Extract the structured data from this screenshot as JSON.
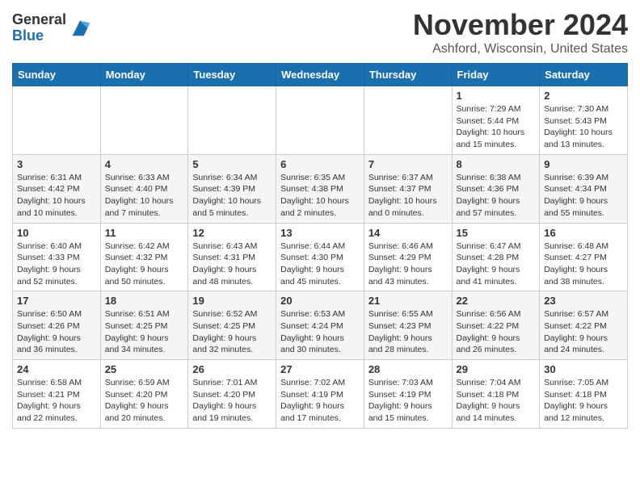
{
  "header": {
    "logo_general": "General",
    "logo_blue": "Blue",
    "month_title": "November 2024",
    "location": "Ashford, Wisconsin, United States"
  },
  "days_of_week": [
    "Sunday",
    "Monday",
    "Tuesday",
    "Wednesday",
    "Thursday",
    "Friday",
    "Saturday"
  ],
  "weeks": [
    [
      {
        "day": "",
        "detail": ""
      },
      {
        "day": "",
        "detail": ""
      },
      {
        "day": "",
        "detail": ""
      },
      {
        "day": "",
        "detail": ""
      },
      {
        "day": "",
        "detail": ""
      },
      {
        "day": "1",
        "detail": "Sunrise: 7:29 AM\nSunset: 5:44 PM\nDaylight: 10 hours and 15 minutes."
      },
      {
        "day": "2",
        "detail": "Sunrise: 7:30 AM\nSunset: 5:43 PM\nDaylight: 10 hours and 13 minutes."
      }
    ],
    [
      {
        "day": "3",
        "detail": "Sunrise: 6:31 AM\nSunset: 4:42 PM\nDaylight: 10 hours and 10 minutes."
      },
      {
        "day": "4",
        "detail": "Sunrise: 6:33 AM\nSunset: 4:40 PM\nDaylight: 10 hours and 7 minutes."
      },
      {
        "day": "5",
        "detail": "Sunrise: 6:34 AM\nSunset: 4:39 PM\nDaylight: 10 hours and 5 minutes."
      },
      {
        "day": "6",
        "detail": "Sunrise: 6:35 AM\nSunset: 4:38 PM\nDaylight: 10 hours and 2 minutes."
      },
      {
        "day": "7",
        "detail": "Sunrise: 6:37 AM\nSunset: 4:37 PM\nDaylight: 10 hours and 0 minutes."
      },
      {
        "day": "8",
        "detail": "Sunrise: 6:38 AM\nSunset: 4:36 PM\nDaylight: 9 hours and 57 minutes."
      },
      {
        "day": "9",
        "detail": "Sunrise: 6:39 AM\nSunset: 4:34 PM\nDaylight: 9 hours and 55 minutes."
      }
    ],
    [
      {
        "day": "10",
        "detail": "Sunrise: 6:40 AM\nSunset: 4:33 PM\nDaylight: 9 hours and 52 minutes."
      },
      {
        "day": "11",
        "detail": "Sunrise: 6:42 AM\nSunset: 4:32 PM\nDaylight: 9 hours and 50 minutes."
      },
      {
        "day": "12",
        "detail": "Sunrise: 6:43 AM\nSunset: 4:31 PM\nDaylight: 9 hours and 48 minutes."
      },
      {
        "day": "13",
        "detail": "Sunrise: 6:44 AM\nSunset: 4:30 PM\nDaylight: 9 hours and 45 minutes."
      },
      {
        "day": "14",
        "detail": "Sunrise: 6:46 AM\nSunset: 4:29 PM\nDaylight: 9 hours and 43 minutes."
      },
      {
        "day": "15",
        "detail": "Sunrise: 6:47 AM\nSunset: 4:28 PM\nDaylight: 9 hours and 41 minutes."
      },
      {
        "day": "16",
        "detail": "Sunrise: 6:48 AM\nSunset: 4:27 PM\nDaylight: 9 hours and 38 minutes."
      }
    ],
    [
      {
        "day": "17",
        "detail": "Sunrise: 6:50 AM\nSunset: 4:26 PM\nDaylight: 9 hours and 36 minutes."
      },
      {
        "day": "18",
        "detail": "Sunrise: 6:51 AM\nSunset: 4:25 PM\nDaylight: 9 hours and 34 minutes."
      },
      {
        "day": "19",
        "detail": "Sunrise: 6:52 AM\nSunset: 4:25 PM\nDaylight: 9 hours and 32 minutes."
      },
      {
        "day": "20",
        "detail": "Sunrise: 6:53 AM\nSunset: 4:24 PM\nDaylight: 9 hours and 30 minutes."
      },
      {
        "day": "21",
        "detail": "Sunrise: 6:55 AM\nSunset: 4:23 PM\nDaylight: 9 hours and 28 minutes."
      },
      {
        "day": "22",
        "detail": "Sunrise: 6:56 AM\nSunset: 4:22 PM\nDaylight: 9 hours and 26 minutes."
      },
      {
        "day": "23",
        "detail": "Sunrise: 6:57 AM\nSunset: 4:22 PM\nDaylight: 9 hours and 24 minutes."
      }
    ],
    [
      {
        "day": "24",
        "detail": "Sunrise: 6:58 AM\nSunset: 4:21 PM\nDaylight: 9 hours and 22 minutes."
      },
      {
        "day": "25",
        "detail": "Sunrise: 6:59 AM\nSunset: 4:20 PM\nDaylight: 9 hours and 20 minutes."
      },
      {
        "day": "26",
        "detail": "Sunrise: 7:01 AM\nSunset: 4:20 PM\nDaylight: 9 hours and 19 minutes."
      },
      {
        "day": "27",
        "detail": "Sunrise: 7:02 AM\nSunset: 4:19 PM\nDaylight: 9 hours and 17 minutes."
      },
      {
        "day": "28",
        "detail": "Sunrise: 7:03 AM\nSunset: 4:19 PM\nDaylight: 9 hours and 15 minutes."
      },
      {
        "day": "29",
        "detail": "Sunrise: 7:04 AM\nSunset: 4:18 PM\nDaylight: 9 hours and 14 minutes."
      },
      {
        "day": "30",
        "detail": "Sunrise: 7:05 AM\nSunset: 4:18 PM\nDaylight: 9 hours and 12 minutes."
      }
    ]
  ]
}
